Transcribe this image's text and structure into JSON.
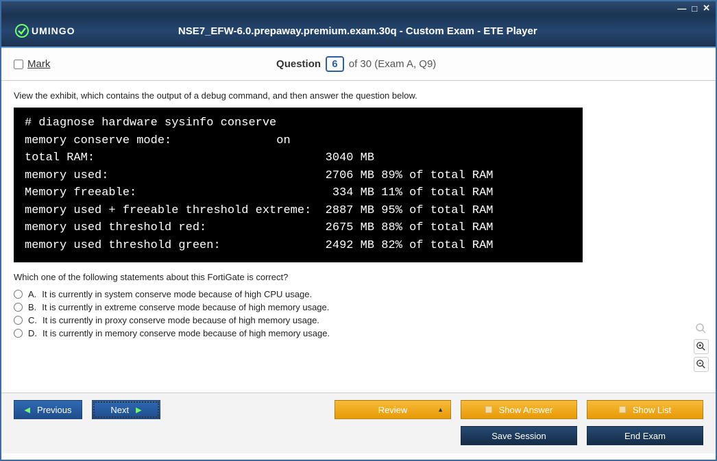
{
  "window": {
    "min": "—",
    "max": "□",
    "close": "✕"
  },
  "logo_text": "UMINGO",
  "header_title": "NSE7_EFW-6.0.prepaway.premium.exam.30q - Custom Exam - ETE Player",
  "mark_label": "Mark",
  "question": {
    "label": "Question",
    "num": "6",
    "total_text": "of 30 (Exam A, Q9)"
  },
  "intro": "View the exhibit, which contains the output of a debug command, and then answer the question below.",
  "terminal": "# diagnose hardware sysinfo conserve\nmemory conserve mode:               on\ntotal RAM:                                 3040 MB\nmemory used:                               2706 MB 89% of total RAM\nMemory freeable:                            334 MB 11% of total RAM\nmemory used + freeable threshold extreme:  2887 MB 95% of total RAM\nmemory used threshold red:                 2675 MB 88% of total RAM\nmemory used threshold green:               2492 MB 82% of total RAM",
  "question_text": "Which one of the following statements about this FortiGate is correct?",
  "options": [
    {
      "letter": "A.",
      "text": "It is currently in system conserve mode because of high CPU usage."
    },
    {
      "letter": "B.",
      "text": "It is currently in extreme conserve mode because of high memory usage."
    },
    {
      "letter": "C.",
      "text": "It is currently in proxy conserve mode because of high memory usage."
    },
    {
      "letter": "D.",
      "text": "It is currently in memory conserve mode because of high memory usage."
    }
  ],
  "buttons": {
    "previous": "Previous",
    "next": "Next",
    "review": "Review",
    "show_answer": "Show Answer",
    "show_list": "Show List",
    "save_session": "Save Session",
    "end_exam": "End Exam"
  }
}
